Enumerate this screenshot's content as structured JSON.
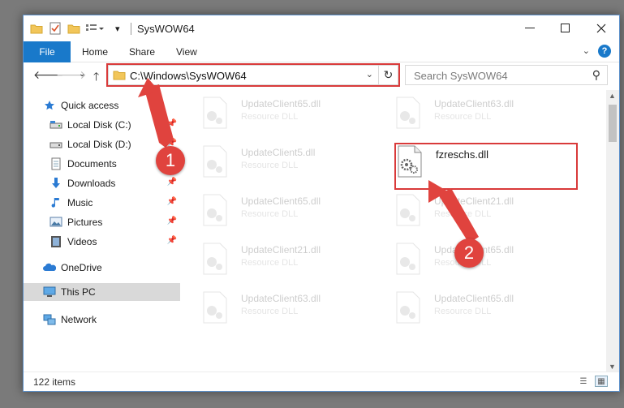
{
  "window": {
    "title": "SysWOW64"
  },
  "ribbon": {
    "file": "File",
    "tabs": [
      "Home",
      "Share",
      "View"
    ],
    "help": "?"
  },
  "nav": {
    "address": "C:\\Windows\\SysWOW64",
    "search_placeholder": "Search SysWOW64"
  },
  "sidebar": {
    "items": [
      {
        "label": "Quick access",
        "icon": "star-icon"
      },
      {
        "label": "Local Disk (C:)",
        "icon": "drive-icon"
      },
      {
        "label": "Local Disk (D:)",
        "icon": "drive-icon"
      },
      {
        "label": "Documents",
        "icon": "documents-icon"
      },
      {
        "label": "Downloads",
        "icon": "downloads-icon"
      },
      {
        "label": "Music",
        "icon": "music-icon"
      },
      {
        "label": "Pictures",
        "icon": "pictures-icon"
      },
      {
        "label": "Videos",
        "icon": "videos-icon"
      },
      {
        "label": "OneDrive",
        "icon": "onedrive-icon"
      },
      {
        "label": "This PC",
        "icon": "pc-icon"
      },
      {
        "label": "Network",
        "icon": "network-icon"
      }
    ]
  },
  "files": [
    {
      "name": "UpdateClient65.dll",
      "type": "Resource DLL"
    },
    {
      "name": "UpdateClient63.dll",
      "type": "Resource DLL"
    },
    {
      "name": "UpdateClient5.dll",
      "type": "Resource DLL"
    },
    {
      "name": "fzreschs.dll",
      "type": ""
    },
    {
      "name": "UpdateClient65.dll",
      "type": "Resource DLL"
    },
    {
      "name": "UpdateClient21.dll",
      "type": "Resource DLL"
    },
    {
      "name": "UpdateClient21.dll",
      "type": "Resource DLL"
    },
    {
      "name": "UpdateClient65.dll",
      "type": "Resource DLL"
    },
    {
      "name": "UpdateClient63.dll",
      "type": "Resource DLL"
    },
    {
      "name": "UpdateClient65.dll",
      "type": "Resource DLL"
    }
  ],
  "status": {
    "items": "122 items"
  },
  "annotations": {
    "badge1": "1",
    "badge2": "2"
  },
  "colors": {
    "accent": "#1979ca",
    "highlight": "#d93a3a"
  }
}
